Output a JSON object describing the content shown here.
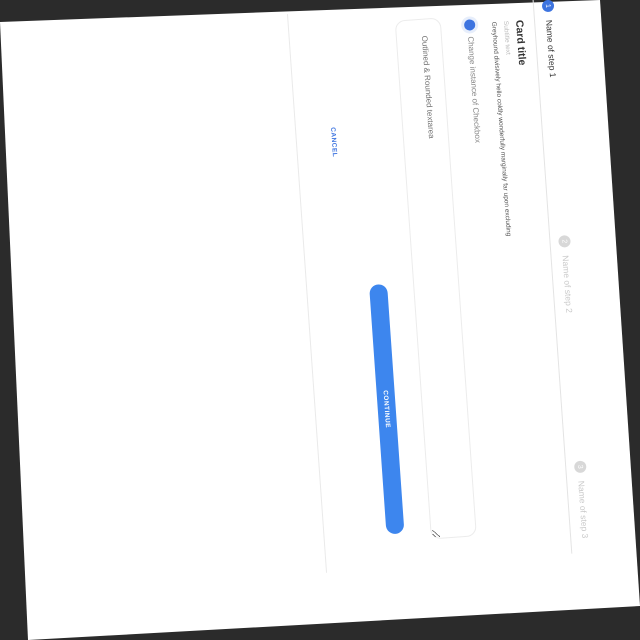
{
  "stepper": {
    "steps": [
      {
        "number": "1",
        "label": "Name of step 1",
        "state": "active"
      },
      {
        "number": "2",
        "label": "Name of step 2",
        "state": "idle"
      },
      {
        "number": "3",
        "label": "Name of step 3",
        "state": "idle"
      }
    ]
  },
  "card": {
    "title": "Card title",
    "subtitle": "Subtitle text",
    "body": "Greyhound divisively hello coldly wonderfully marginally far upon excluding"
  },
  "checkbox": {
    "label": "Change instance of Checkbox",
    "checked": true
  },
  "textarea": {
    "placeholder": "Outlined & Rounded textarea"
  },
  "actions": {
    "cancel_label": "CANCEL",
    "continue_label": "CONTINUE"
  },
  "colors": {
    "accent": "#3d74e0",
    "button": "#3d86ee",
    "inactive": "#d8d8d8"
  }
}
